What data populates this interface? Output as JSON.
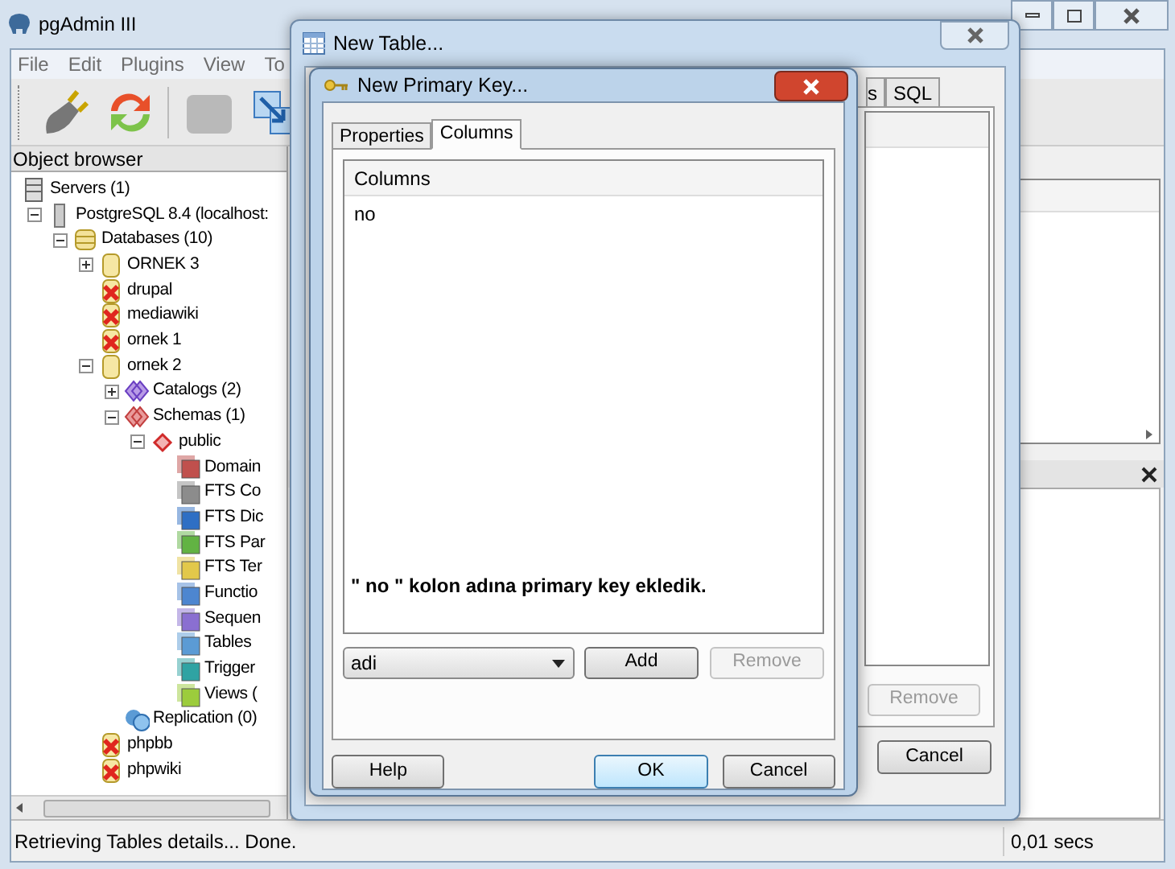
{
  "main_window": {
    "title": "pgAdmin III",
    "menu": [
      "File",
      "Edit",
      "Plugins",
      "View",
      "To"
    ],
    "toolbar": [
      {
        "kind": "plug",
        "disabled": false
      },
      {
        "kind": "refresh",
        "disabled": false
      },
      {
        "kind": "blank",
        "disabled": true
      },
      {
        "kind": "arrow",
        "disabled": false
      }
    ],
    "object_browser": {
      "title": "Object browser",
      "tree": [
        {
          "label": "Servers (1)",
          "kind": "servers",
          "children": [
            {
              "label": "PostgreSQL 8.4 (localhost:",
              "kind": "server",
              "expanded": true,
              "children": [
                {
                  "label": "Databases (10)",
                  "kind": "databases",
                  "expanded": true,
                  "children": [
                    {
                      "label": "ORNEK 3",
                      "kind": "database",
                      "expanded": false
                    },
                    {
                      "label": "drupal",
                      "kind": "db-off"
                    },
                    {
                      "label": "mediawiki",
                      "kind": "db-off"
                    },
                    {
                      "label": "ornek 1",
                      "kind": "db-off"
                    },
                    {
                      "label": "ornek 2",
                      "kind": "database",
                      "expanded": true,
                      "children": [
                        {
                          "label": "Catalogs (2)",
                          "kind": "catalogs",
                          "expanded": false
                        },
                        {
                          "label": "Schemas (1)",
                          "kind": "schemas",
                          "expanded": true,
                          "children": [
                            {
                              "label": "public",
                              "kind": "schema",
                              "expanded": true,
                              "children": [
                                {
                                  "label": "Domain",
                                  "kind": "collection",
                                  "color": "#c0504d"
                                },
                                {
                                  "label": "FTS Co",
                                  "kind": "collection",
                                  "color": "#8c8c8c"
                                },
                                {
                                  "label": "FTS Dic",
                                  "kind": "collection",
                                  "color": "#2f6fc4"
                                },
                                {
                                  "label": "FTS Par",
                                  "kind": "collection",
                                  "color": "#62b343"
                                },
                                {
                                  "label": "FTS Ter",
                                  "kind": "collection",
                                  "color": "#e2c84a"
                                },
                                {
                                  "label": "Functio",
                                  "kind": "collection",
                                  "color": "#4d86d0"
                                },
                                {
                                  "label": "Sequen",
                                  "kind": "collection",
                                  "color": "#8a6fd1"
                                },
                                {
                                  "label": "Tables",
                                  "kind": "collection",
                                  "color": "#5b9bd5"
                                },
                                {
                                  "label": "Trigger",
                                  "kind": "collection",
                                  "color": "#2fa3a3"
                                },
                                {
                                  "label": "Views (",
                                  "kind": "collection",
                                  "color": "#9ccc3c"
                                }
                              ]
                            }
                          ]
                        },
                        {
                          "label": "Replication (0)",
                          "kind": "replication"
                        }
                      ]
                    },
                    {
                      "label": "phpbb",
                      "kind": "db-off"
                    },
                    {
                      "label": "phpwiki",
                      "kind": "db-off"
                    }
                  ]
                }
              ]
            }
          ]
        }
      ]
    },
    "status_bar": {
      "message": "Retrieving Tables details... Done.",
      "time": "0,01 secs"
    }
  },
  "new_table_dialog": {
    "title": "New Table...",
    "tabs": [
      {
        "label": "s",
        "selected": false
      },
      {
        "label": "SQL",
        "selected": false
      }
    ],
    "remove_button": {
      "label": "Remove",
      "disabled": true
    },
    "cancel_button": {
      "label": "Cancel",
      "disabled": false
    }
  },
  "primary_key_dialog": {
    "title": "New Primary Key...",
    "tabs": [
      {
        "label": "Properties",
        "selected": false
      },
      {
        "label": "Columns",
        "selected": true
      }
    ],
    "columns_list": {
      "header": "Columns",
      "rows": [
        "no"
      ]
    },
    "note": "\" no \" kolon adına primary key ekledik.",
    "column_select": {
      "value": "adi"
    },
    "list_buttons": [
      {
        "label": "Add",
        "disabled": false
      },
      {
        "label": "Remove",
        "disabled": true
      }
    ],
    "buttons": [
      {
        "label": "Help",
        "default": false
      },
      {
        "label": "OK",
        "default": true
      },
      {
        "label": "Cancel",
        "default": false
      }
    ]
  }
}
